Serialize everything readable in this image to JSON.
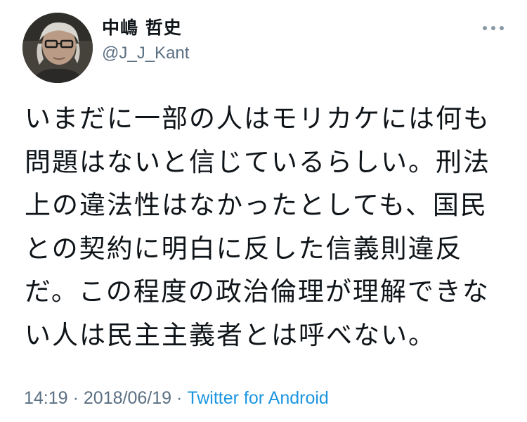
{
  "tweet": {
    "author": {
      "display_name": "中嶋 哲史",
      "handle": "@J_J_Kant",
      "avatar_icon": "profile-photo"
    },
    "more_icon": "more-dots-icon",
    "text_lines": [
      "いまだに一部の人はモリカケには何も",
      "問題はないと信じているらしい。刑法",
      "上の違法性はなかったとしても、国民",
      "との契約に明白に反した信義則違反",
      "だ。この程度の政治倫理が理解できな",
      "い人は民主主義者とは呼べない。"
    ],
    "meta": {
      "time": "14:19",
      "separator": "·",
      "date": "2018/06/19",
      "source": "Twitter for Android"
    },
    "colors": {
      "text": "#0f1419",
      "secondary": "#5b7083",
      "link": "#1b95e0"
    }
  }
}
